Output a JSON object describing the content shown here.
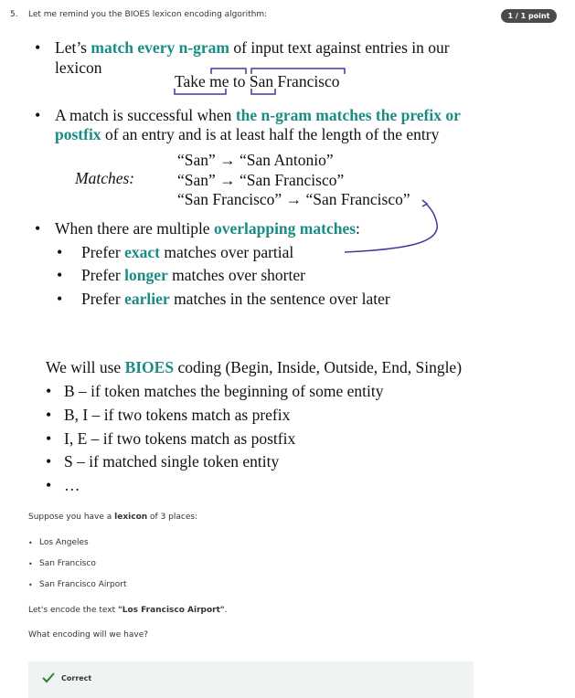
{
  "question": {
    "number": "5.",
    "prompt": "Let me remind you the BIOES lexicon encoding algorithm:",
    "score": "1 / 1 point"
  },
  "slide1": {
    "b1_pre": "Let’s ",
    "b1_hl": "match every n-gram",
    "b1_post": " of input text against entries in our",
    "b1_line2": "lexicon",
    "example_text": "Take me to San Francisco",
    "b2_pre": "A match is successful when ",
    "b2_hl1": "the n-gram matches the prefix or",
    "b2_hl2": "postfix",
    "b2_post": " of an entry and is at least half the length of the entry",
    "matches_label": "Matches:",
    "match1": "“San” → “San Antonio”",
    "match2": "“San” → “San Francisco”",
    "match3": "“San Francisco” → “San Francisco”",
    "b3_pre": "When there are multiple ",
    "b3_hl": "overlapping matches",
    "b3_post": ":",
    "sub1_pre": "Prefer ",
    "sub1_hl": "exact",
    "sub1_post": " matches over partial",
    "sub2_pre": "Prefer ",
    "sub2_hl": "longer",
    "sub2_post": " matches over shorter",
    "sub3_pre": "Prefer ",
    "sub3_hl": "earlier",
    "sub3_post": " matches in the sentence over later"
  },
  "slide2": {
    "intro_pre": "We will use ",
    "intro_hl": "BIOES",
    "intro_post": " coding (Begin, Inside, Outside, End, Single)",
    "items": [
      "B – if token matches the beginning of some entity",
      "B, I – if two tokens match as prefix",
      "I, E – if two tokens match as postfix",
      "S – if matched single token entity",
      "…"
    ]
  },
  "body": {
    "lexicon_pre": "Suppose you have a ",
    "lexicon_bold": "lexicon",
    "lexicon_post": " of 3 places:",
    "places": [
      "Los Angeles",
      "San Francisco",
      "San Francisco Airport"
    ],
    "encode_pre": "Let's encode the text ",
    "encode_bold": "\"Los Francisco Airport\"",
    "encode_post": ".",
    "ask": "What encoding will we have?"
  },
  "feedback": {
    "label": "Correct"
  },
  "colors": {
    "accent": "#1a8c84",
    "bracket": "#3b3b9a",
    "badge": "#4a4a4a",
    "check": "#2e7d32"
  }
}
